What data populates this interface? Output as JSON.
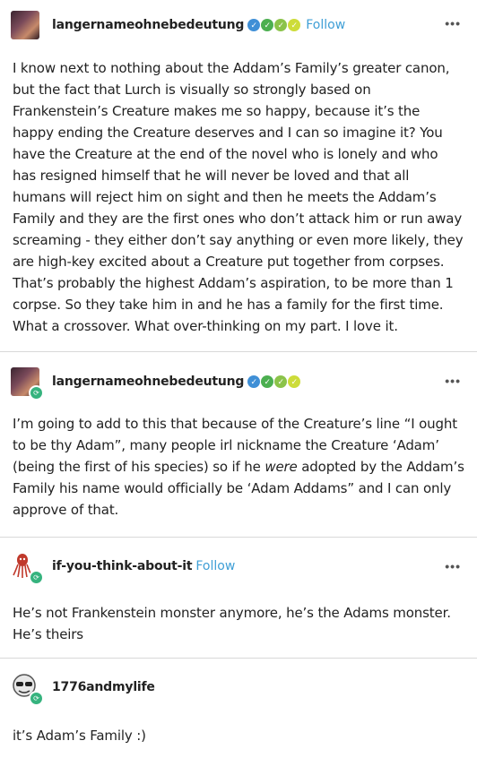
{
  "posts": [
    {
      "username": "langernameohnebedeutung",
      "follow_label": "Follow",
      "more_label": "•••",
      "badge_colors": [
        "#3f8fd6",
        "#4caf50",
        "#8bc34a",
        "#cddc39"
      ],
      "body": "I know next to nothing about the Addam’s Family’s greater canon, but the fact that Lurch is visually so strongly based on Frankenstein’s Creature makes me so happy, because it’s the happy ending the Creature deserves and I can so imagine it? You have the Creature at the end of the novel who is lonely and who has resigned himself that he will never be loved and that all humans will reject him on sight and then he meets the Addam’s Family and they are the first ones who don’t attack him or run away screaming - they either don’t say anything or even more likely, they are high-key excited about a Creature put together from corpses. That’s probably the highest Addam’s aspiration, to be more than 1 corpse. So they take him in and he has a family for the first time. What a crossover. What over-thinking on my part. I love it."
    },
    {
      "username": "langernameohnebedeutung",
      "more_label": "•••",
      "badge_colors": [
        "#3f8fd6",
        "#4caf50",
        "#8bc34a",
        "#cddc39"
      ],
      "body_before": "I’m going to add to this that because of the Creature’s line “I ought to be thy Adam”, many people irl nickname the Creature ‘Adam’ (being the first of his species) so if he ",
      "body_em": "were",
      "body_after": " adopted by the Addam’s Family his name would officially be ‘Adam Addams” and I can only approve of that."
    },
    {
      "username": "if-you-think-about-it",
      "follow_label": "Follow",
      "more_label": "•••",
      "body": "He’s not Frankenstein monster anymore, he’s the Adams monster. He’s theirs"
    },
    {
      "username": "1776andmylife",
      "body": "it’s Adam’s Family :)"
    }
  ],
  "colors": {
    "follow": "#3f9fd6",
    "reblog_badge": "#36b37e",
    "divider": "#d9d9d9"
  }
}
